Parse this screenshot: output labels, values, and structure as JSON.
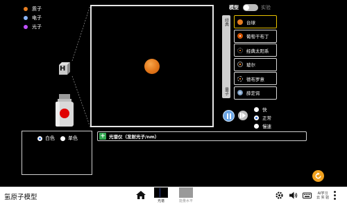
{
  "legend": [
    {
      "label": "质子",
      "color": "#e67e22"
    },
    {
      "label": "电子",
      "color": "#8ab4f8"
    },
    {
      "label": "光子",
      "color": "#c050ff"
    }
  ],
  "gun": {
    "label": "H"
  },
  "model_toggle": {
    "left_label": "模型",
    "right_label": "实验"
  },
  "classic_bar": {
    "top_label": "经典",
    "bottom_label": "量子"
  },
  "models": [
    {
      "label": "台球",
      "icon": "billiard-icon",
      "color": "#e67e22",
      "selected": true
    },
    {
      "label": "葡萄干布丁",
      "icon": "plum-pudding-icon",
      "color": "#d35400",
      "selected": false
    },
    {
      "label": "经典太阳系",
      "icon": "solar-system-icon",
      "color": "#e67e22",
      "selected": false
    },
    {
      "label": "玻尔",
      "icon": "bohr-icon",
      "color": "#e67e22",
      "selected": false
    },
    {
      "label": "德布罗意",
      "icon": "de-broglie-icon",
      "color": "#e67e22",
      "selected": false
    },
    {
      "label": "薛定谔",
      "icon": "schrodinger-icon",
      "color": "#7fa2c8",
      "selected": false
    }
  ],
  "speed": {
    "options": [
      "快",
      "正常",
      "慢速"
    ],
    "selected": "正常"
  },
  "spectrometer": {
    "title": "光谱仪（发射光子/nm）"
  },
  "light": {
    "options": [
      "白色",
      "单色"
    ],
    "selected": "白色"
  },
  "navbar": {
    "title": "氢原子模型",
    "screens": [
      {
        "label": "光谱",
        "active": true
      },
      {
        "label": "能量水平",
        "active": false
      }
    ],
    "brand_line1": "AI学习",
    "brand_line2": "云 实 验"
  },
  "colors": {
    "accent_selected": "#e8c200",
    "play": "#6ba6e6",
    "reset": "#f0a11e",
    "spectro_plus": "#33a852"
  }
}
